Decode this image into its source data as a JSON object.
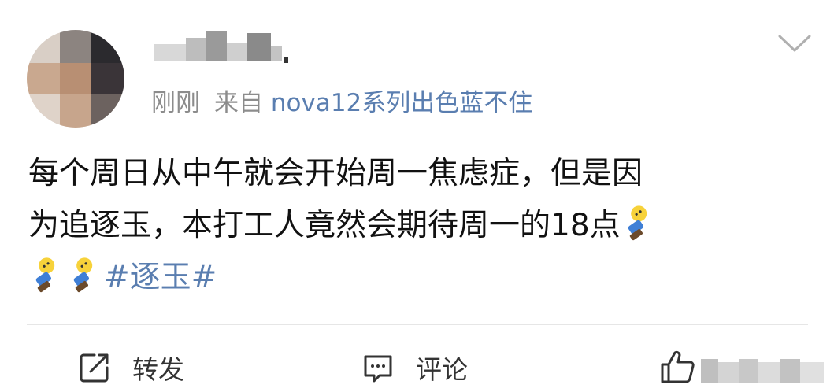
{
  "post": {
    "meta": {
      "time": "刚刚",
      "source_prefix": "来自",
      "source_device": "nova12系列出色蓝不住"
    },
    "body": {
      "line1": "每个周日从中午就会开始周一焦虑症，但是因",
      "line2": "为追逐玉，本打工人竟然会期待周一的18点",
      "hashtag": "#逐玉#"
    },
    "emoji": "dying-face-emoji",
    "actions": {
      "repost_label": "转发",
      "comment_label": "评论"
    },
    "colors": {
      "link": "#5a7eb0",
      "meta": "#8c8c8c",
      "text": "#111111"
    }
  }
}
